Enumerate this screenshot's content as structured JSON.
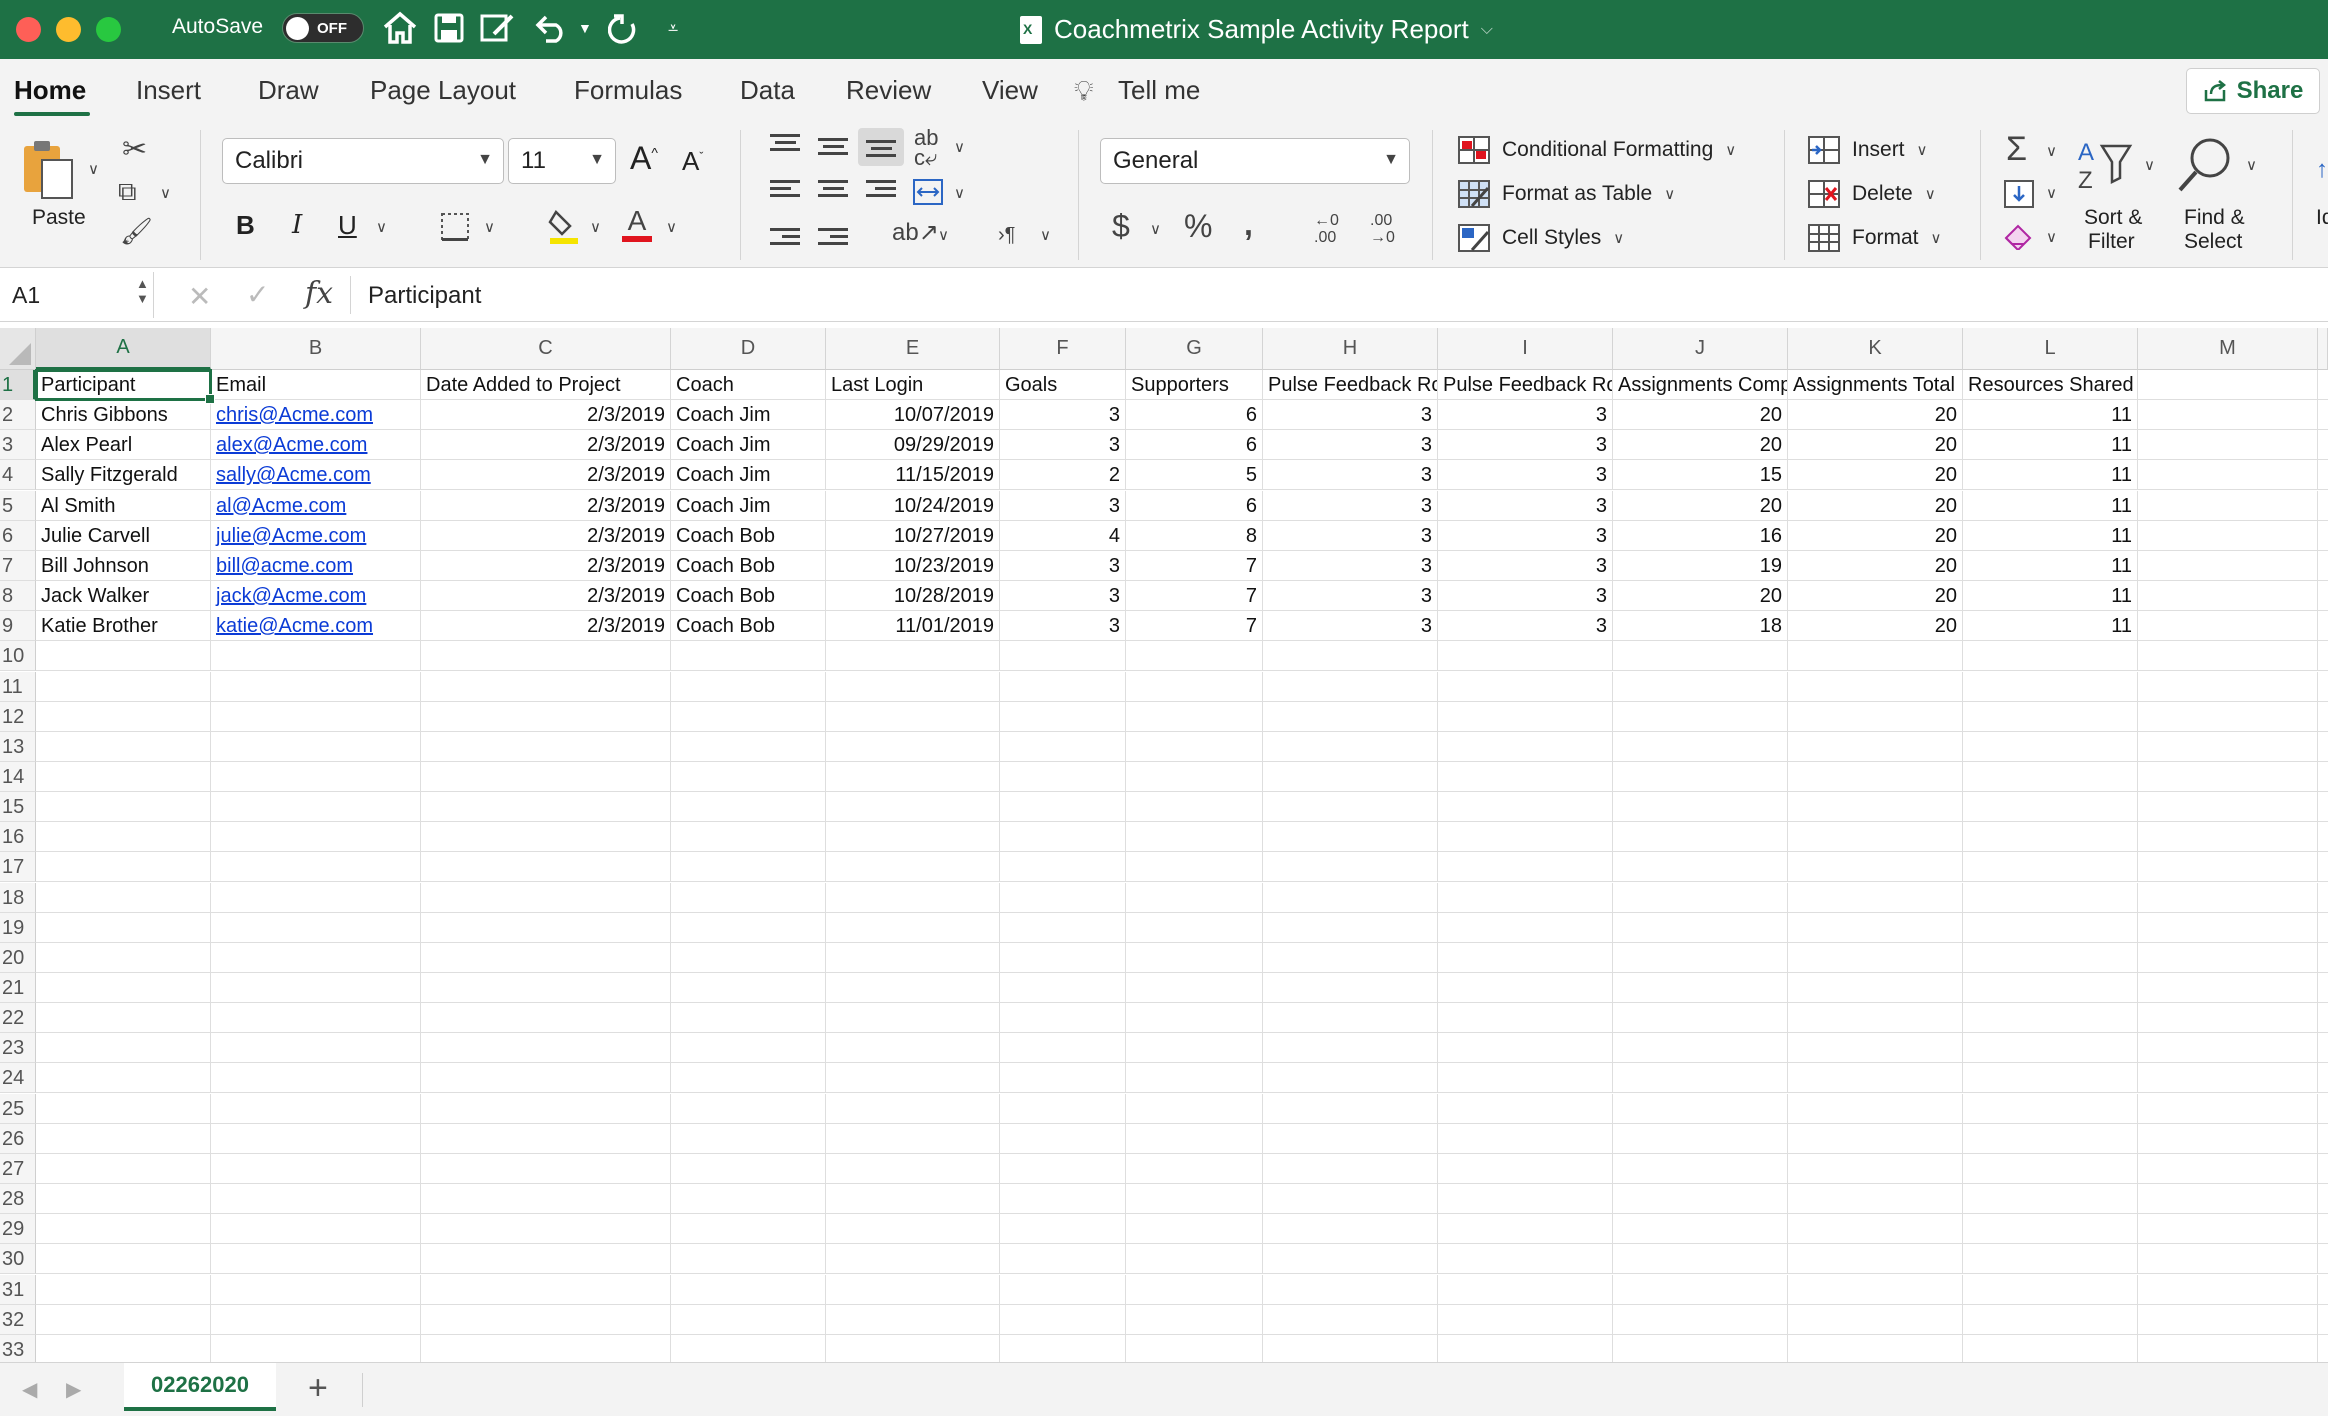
{
  "titlebar": {
    "autosave_label": "AutoSave",
    "autosave_state": "OFF",
    "document_title": "Coachmetrix Sample Activity Report"
  },
  "ribbon_tabs": [
    "Home",
    "Insert",
    "Draw",
    "Page Layout",
    "Formulas",
    "Data",
    "Review",
    "View",
    "Tell me"
  ],
  "active_tab": "Home",
  "share_label": "Share",
  "ribbon": {
    "paste_label": "Paste",
    "font_name": "Calibri",
    "font_size": "11",
    "number_format": "General",
    "conditional_formatting": "Conditional Formatting",
    "format_as_table": "Format as Table",
    "cell_styles": "Cell Styles",
    "insert": "Insert",
    "delete": "Delete",
    "format": "Format",
    "sort_filter_1": "Sort &",
    "sort_filter_2": "Filter",
    "find_select_1": "Find &",
    "find_select_2": "Select",
    "truncated": "Id"
  },
  "formula_bar": {
    "cell_ref": "A1",
    "content": "Participant"
  },
  "columns": [
    {
      "letter": "A"
    },
    {
      "letter": "B"
    },
    {
      "letter": "C"
    },
    {
      "letter": "D"
    },
    {
      "letter": "E"
    },
    {
      "letter": "F"
    },
    {
      "letter": "G"
    },
    {
      "letter": "H"
    },
    {
      "letter": "I"
    },
    {
      "letter": "J"
    },
    {
      "letter": "K"
    },
    {
      "letter": "L"
    },
    {
      "letter": "M"
    }
  ],
  "header_row": [
    "Participant",
    "Email",
    "Date Added to Project",
    "Coach",
    "Last Login",
    "Goals",
    "Supporters",
    "Pulse Feedback Rou",
    "Pulse Feedback Rou",
    "Assignments Comp",
    "Assignments Total",
    "Resources Shared with Participant",
    ""
  ],
  "data_rows": [
    [
      "Chris Gibbons",
      "chris@Acme.com",
      "2/3/2019",
      "Coach Jim",
      "10/07/2019",
      "3",
      "6",
      "3",
      "3",
      "20",
      "20",
      "11",
      ""
    ],
    [
      "Alex Pearl",
      "alex@Acme.com",
      "2/3/2019",
      "Coach Jim",
      "09/29/2019",
      "3",
      "6",
      "3",
      "3",
      "20",
      "20",
      "11",
      ""
    ],
    [
      "Sally Fitzgerald",
      "sally@Acme.com",
      "2/3/2019",
      "Coach Jim",
      "11/15/2019",
      "2",
      "5",
      "3",
      "3",
      "15",
      "20",
      "11",
      ""
    ],
    [
      "Al Smith",
      "al@Acme.com",
      "2/3/2019",
      "Coach Jim",
      "10/24/2019",
      "3",
      "6",
      "3",
      "3",
      "20",
      "20",
      "11",
      ""
    ],
    [
      "Julie Carvell",
      "julie@Acme.com",
      "2/3/2019",
      "Coach Bob",
      "10/27/2019",
      "4",
      "8",
      "3",
      "3",
      "16",
      "20",
      "11",
      ""
    ],
    [
      "Bill Johnson",
      "bill@acme.com",
      "2/3/2019",
      "Coach Bob",
      "10/23/2019",
      "3",
      "7",
      "3",
      "3",
      "19",
      "20",
      "11",
      ""
    ],
    [
      "Jack Walker",
      "jack@Acme.com",
      "2/3/2019",
      "Coach Bob",
      "10/28/2019",
      "3",
      "7",
      "3",
      "3",
      "20",
      "20",
      "11",
      ""
    ],
    [
      "Katie Brother",
      "katie@Acme.com",
      "2/3/2019",
      "Coach Bob",
      "11/01/2019",
      "3",
      "7",
      "3",
      "3",
      "18",
      "20",
      "11",
      ""
    ]
  ],
  "row_numbers": [
    "1",
    "2",
    "3",
    "4",
    "5",
    "6",
    "7",
    "8",
    "9",
    "10",
    "11",
    "12",
    "13",
    "14",
    "15",
    "16",
    "17",
    "18",
    "19",
    "20",
    "21",
    "22",
    "23",
    "24",
    "25",
    "26",
    "27",
    "28",
    "29",
    "30",
    "31",
    "32",
    "33"
  ],
  "sheet_tab": "02262020",
  "colors": {
    "accent": "#1e7145",
    "link": "#0b3bd6"
  }
}
